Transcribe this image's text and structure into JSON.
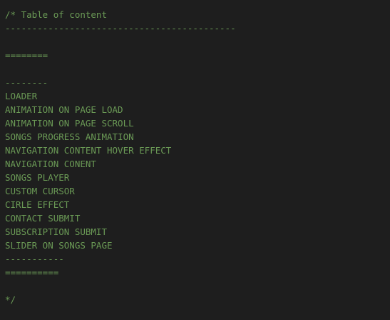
{
  "editor": {
    "lines": [
      "/* Table of content",
      "-------------------------------------------",
      "",
      "========",
      "",
      "--------",
      "LOADER",
      "ANIMATION ON PAGE LOAD",
      "ANIMATION ON PAGE SCROLL",
      "SONGS PROGRESS ANIMATION",
      "NAVIGATION CONTENT HOVER EFFECT",
      "NAVIGATION CONENT",
      "SONGS PLAYER",
      "CUSTOM CURSOR",
      "CIRLE EFFECT",
      "CONTACT SUBMIT",
      "SUBSCRIPTION SUBMIT",
      "SLIDER ON SONGS PAGE",
      "-----------",
      "==========",
      "",
      "*/"
    ],
    "colors": {
      "background": "#1e1e1e",
      "comment": "#6a9955"
    }
  }
}
